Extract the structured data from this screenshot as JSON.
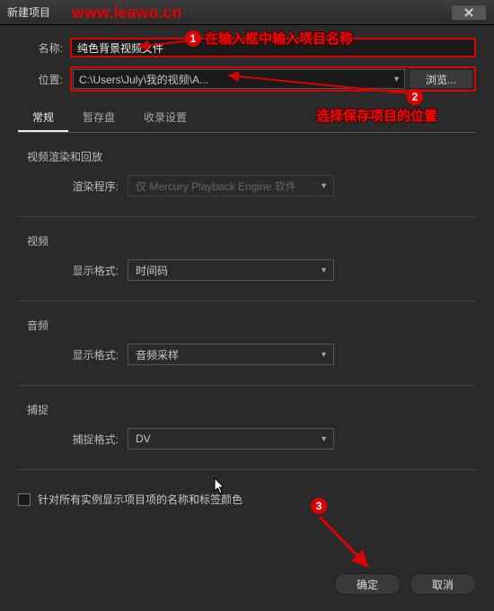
{
  "window": {
    "title": "新建项目"
  },
  "watermark": "www.leawo.cn",
  "labels": {
    "name": "名称:",
    "location": "位置:"
  },
  "name_input": {
    "value": "纯色背景视频文件"
  },
  "location": {
    "value": "C:\\Users\\July\\我的视频\\A..."
  },
  "browse": "浏览...",
  "tabs": [
    "常规",
    "暂存盘",
    "收录设置"
  ],
  "sections": {
    "render": {
      "title": "视频渲染和回放",
      "renderer_label": "渲染程序:",
      "renderer_value": "仅 Mercury Playback Engine 软件"
    },
    "video": {
      "title": "视频",
      "format_label": "显示格式:",
      "format_value": "时间码"
    },
    "audio": {
      "title": "音频",
      "format_label": "显示格式:",
      "format_value": "音频采样"
    },
    "capture": {
      "title": "捕捉",
      "format_label": "捕捉格式:",
      "format_value": "DV"
    }
  },
  "checkbox_label": "针对所有实例显示项目项的名称和标签颜色",
  "buttons": {
    "ok": "确定",
    "cancel": "取消"
  },
  "annotations": {
    "a1": "在输入框中输入项目名称",
    "a2": "选择保存项目的位置"
  }
}
